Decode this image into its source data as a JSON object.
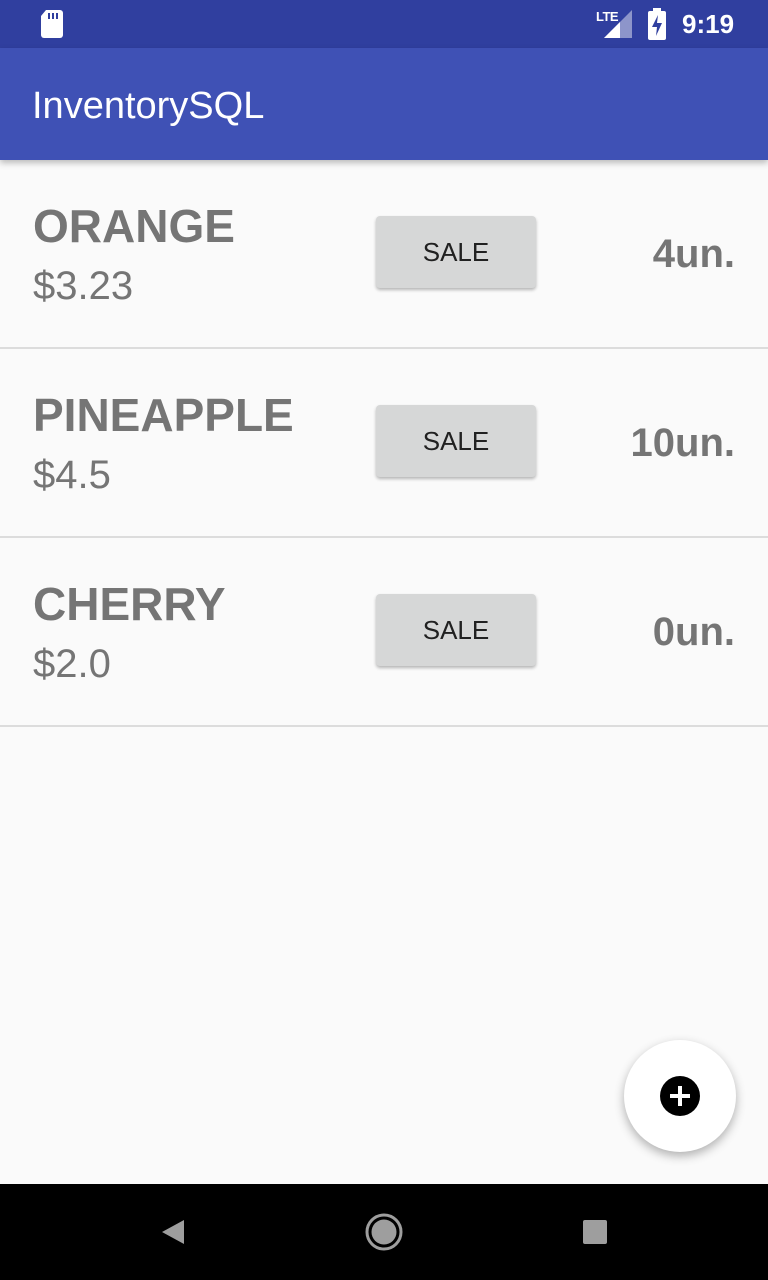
{
  "status_bar": {
    "network_label": "LTE",
    "time": "9:19",
    "icons": [
      "sd-card-icon",
      "signal-icon",
      "battery-charging-icon"
    ]
  },
  "app_bar": {
    "title": "InventorySQL",
    "color": "#3f51b5"
  },
  "products": [
    {
      "name": "ORANGE",
      "price": "$3.23",
      "sale_label": "SALE",
      "quantity": "4un."
    },
    {
      "name": "PINEAPPLE",
      "price": "$4.5",
      "sale_label": "SALE",
      "quantity": "10un."
    },
    {
      "name": "CHERRY",
      "price": "$2.0",
      "sale_label": "SALE",
      "quantity": "0un."
    }
  ],
  "fab": {
    "icon": "add-circle-icon"
  },
  "nav_bar": {
    "icons": [
      "back-icon",
      "home-icon",
      "recents-icon"
    ]
  },
  "colors": {
    "status_bar": "#303f9f",
    "primary": "#3f51b5",
    "text_secondary": "#757575",
    "button": "#d6d7d7"
  }
}
